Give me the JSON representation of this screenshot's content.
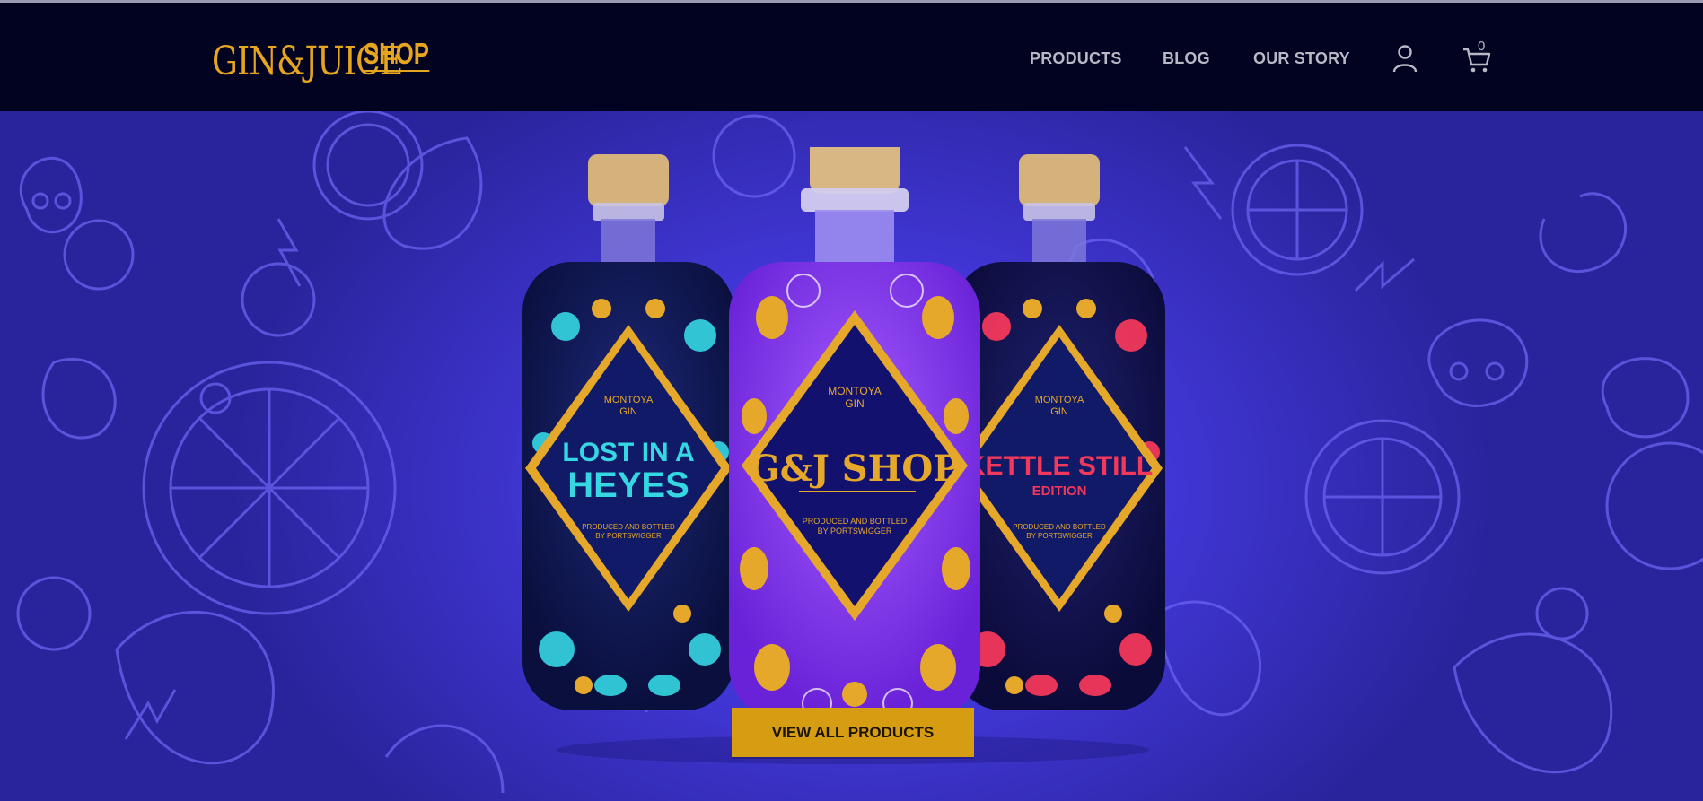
{
  "brand": {
    "logo_main": "GIN&JUICE",
    "logo_shop": "SHOP",
    "color": "#e5a51f"
  },
  "nav": {
    "items": [
      {
        "label": "PRODUCTS"
      },
      {
        "label": "BLOG"
      },
      {
        "label": "OUR STORY"
      }
    ],
    "account_icon": "user-icon",
    "cart_icon": "shopping-cart-icon",
    "cart_count": "0"
  },
  "hero": {
    "bottles": [
      {
        "brand": "MONTOYA",
        "brand_sub": "GIN",
        "name_line1": "LOST IN A",
        "name_line2": "HEYES",
        "produced_line1": "PRODUCED AND BOTTLED",
        "produced_line2": "BY PORTSWIGGER",
        "accent": "#35d7e3",
        "body": "#0f1a5a"
      },
      {
        "brand": "MONTOYA",
        "brand_sub": "GIN",
        "name_line1": "G&J SHOP",
        "name_line2": "",
        "produced_line1": "PRODUCED AND BOTTLED",
        "produced_line2": "BY PORTSWIGGER",
        "accent": "#e6a82a",
        "body": "#8a3dec"
      },
      {
        "brand": "MONTOYA",
        "brand_sub": "GIN",
        "name_line1": "KETTLE STILL",
        "name_line2": "EDITION",
        "produced_line1": "PRODUCED AND BOTTLED",
        "produced_line2": "BY PORTSWIGGER",
        "accent": "#f2385b",
        "body": "#1a1650"
      }
    ],
    "cta_label": "VIEW ALL PRODUCTS"
  },
  "colors": {
    "nav_bg": "#020221",
    "hero_bg": "#4237d9",
    "cta_bg": "#d79d12",
    "nav_text": "#b9b9c6"
  }
}
